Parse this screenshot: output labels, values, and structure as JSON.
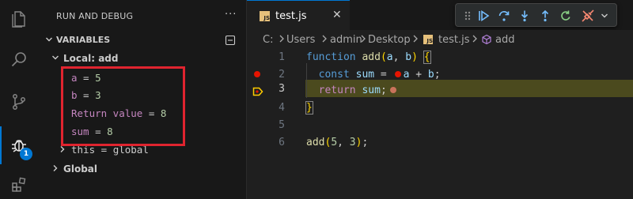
{
  "sidebar": {
    "title": "RUN AND DEBUG",
    "more_label": "···",
    "section_label": "VARIABLES",
    "local_scope": {
      "label": "Local: add",
      "vars": [
        {
          "name": "a",
          "eq": " = ",
          "value": "5"
        },
        {
          "name": "b",
          "eq": " = ",
          "value": "3"
        },
        {
          "name": "Return value",
          "eq": " = ",
          "value": "8"
        },
        {
          "name": "sum",
          "eq": " = ",
          "value": "8"
        }
      ],
      "this_var": {
        "name": "this",
        "eq": " = ",
        "value": "global"
      }
    },
    "global_scope": {
      "label": "Global"
    }
  },
  "activity_bar": {
    "debug_badge": "1",
    "icons": [
      "explorer-icon",
      "search-icon",
      "source-control-icon",
      "run-debug-icon",
      "extensions-icon"
    ]
  },
  "editor": {
    "tab": {
      "icon_text": "JS",
      "label": "test.js",
      "close": "✕"
    },
    "breadcrumb": [
      "C:",
      "Users",
      "admin",
      "Desktop",
      "test.js",
      "add"
    ],
    "line_numbers": [
      "1",
      "2",
      "3",
      "4",
      "5",
      "6"
    ],
    "code": {
      "l1": {
        "kw": "function",
        "fn": "add",
        "open": "(",
        "p1": "a",
        "comma": ", ",
        "p2": "b",
        "close": ")",
        "brace": "{"
      },
      "l2": {
        "kw": "const",
        "var": "sum",
        "eq": " = ",
        "a": "a",
        "plus": " + ",
        "b": "b",
        "semi": ";"
      },
      "l3": {
        "kw": "return",
        "var": "sum",
        "semi": ";"
      },
      "l4": {
        "brace": "}"
      },
      "l6": {
        "fn": "add",
        "open": "(",
        "n1": "5",
        "comma": ", ",
        "n2": "3",
        "close": ")",
        "semi": ";"
      }
    }
  },
  "debug_toolbar": {
    "icons": [
      "drag-grip-icon",
      "continue-icon",
      "step-over-icon",
      "step-into-icon",
      "step-out-icon",
      "restart-icon",
      "disconnect-icon",
      "dropdown-chevron-icon"
    ]
  },
  "colors": {
    "accent": "#0078d4",
    "highlight_box": "#e0242f",
    "breakpoint": "#e51400",
    "current_line": "#4b4a1e"
  }
}
